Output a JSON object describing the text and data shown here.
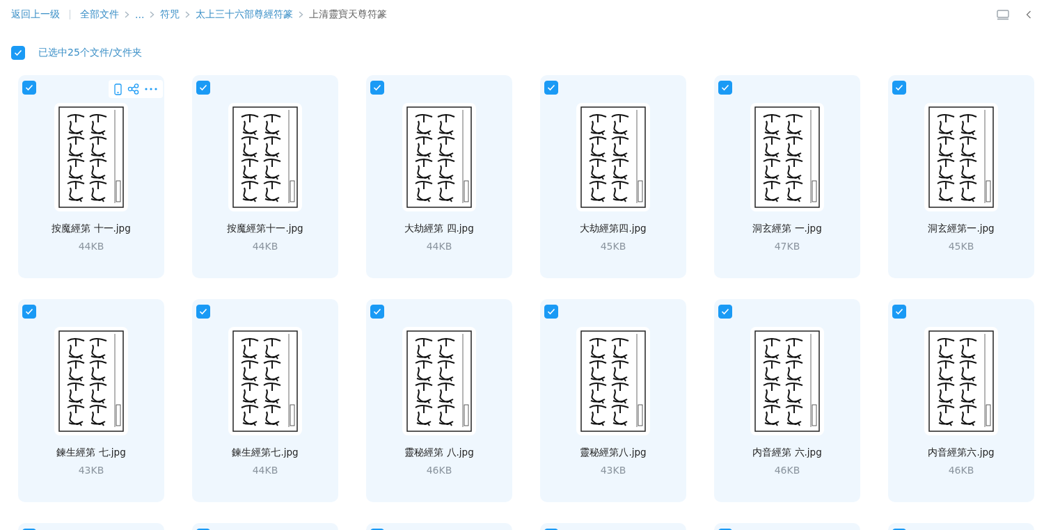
{
  "breadcrumb": {
    "back": "返回上一级",
    "items": [
      {
        "label": "全部文件",
        "current": false
      },
      {
        "label": "...",
        "current": false
      },
      {
        "label": "符咒",
        "current": false
      },
      {
        "label": "太上三十六部尊經符篆",
        "current": false
      },
      {
        "label": "上清靈寶天尊符篆",
        "current": true
      }
    ]
  },
  "selection": {
    "checked": true,
    "label": "已选中25个文件/文件夹"
  },
  "files": [
    {
      "name": "按魔經第 十一.jpg",
      "size": "44KB",
      "checked": true,
      "hovered": true
    },
    {
      "name": "按魔經第十一.jpg",
      "size": "44KB",
      "checked": true,
      "hovered": false
    },
    {
      "name": "大劫經第 四.jpg",
      "size": "44KB",
      "checked": true,
      "hovered": false
    },
    {
      "name": "大劫經第四.jpg",
      "size": "45KB",
      "checked": true,
      "hovered": false
    },
    {
      "name": "洞玄經第 一.jpg",
      "size": "47KB",
      "checked": true,
      "hovered": false
    },
    {
      "name": "洞玄經第一.jpg",
      "size": "45KB",
      "checked": true,
      "hovered": false
    },
    {
      "name": "鍊生經第 七.jpg",
      "size": "43KB",
      "checked": true,
      "hovered": false
    },
    {
      "name": "鍊生經第七.jpg",
      "size": "44KB",
      "checked": true,
      "hovered": false
    },
    {
      "name": "靈秘經第 八.jpg",
      "size": "46KB",
      "checked": true,
      "hovered": false
    },
    {
      "name": "靈秘經第八.jpg",
      "size": "43KB",
      "checked": true,
      "hovered": false
    },
    {
      "name": "内音經第 六.jpg",
      "size": "46KB",
      "checked": true,
      "hovered": false
    },
    {
      "name": "内音經第六.jpg",
      "size": "46KB",
      "checked": true,
      "hovered": false
    },
    {
      "checked": true,
      "hovered": false
    },
    {
      "checked": true,
      "hovered": false
    },
    {
      "checked": true,
      "hovered": false
    },
    {
      "checked": true,
      "hovered": false
    },
    {
      "checked": true,
      "hovered": false
    },
    {
      "checked": true,
      "hovered": false
    }
  ]
}
